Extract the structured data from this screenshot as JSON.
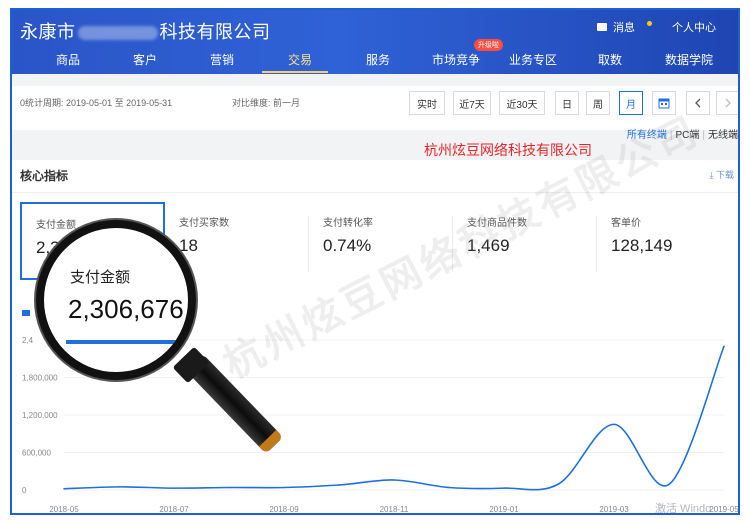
{
  "header": {
    "title_prefix": "永康市",
    "title_suffix": "科技有限公司",
    "messages_label": "消息",
    "user_center_label": "个人中心"
  },
  "nav": {
    "items": [
      {
        "label": "商品"
      },
      {
        "label": "客户"
      },
      {
        "label": "营销"
      },
      {
        "label": "交易"
      },
      {
        "label": "服务"
      },
      {
        "label": "市场竞争"
      },
      {
        "label": "业务专区"
      },
      {
        "label": "取数"
      },
      {
        "label": "数据学院"
      }
    ],
    "active": "交易",
    "upgrade_badge": "升级啦"
  },
  "filter": {
    "period_label": "0统计周期:",
    "period_value": "2019-05-01 至 2019-05-31",
    "compare_label": "对比维度:",
    "compare_value": "前一月",
    "buttons": [
      "实时",
      "近7天",
      "近30天",
      "日",
      "周",
      "月"
    ],
    "active_button": "月"
  },
  "terminal": {
    "all": "所有终端",
    "pc": "PC端",
    "wireless": "无线端"
  },
  "company_overlay": "杭州炫豆网络科技有限公司",
  "core": {
    "title": "核心指标",
    "download": "下载",
    "metrics": [
      {
        "label": "支付金额",
        "value": "2,306,676"
      },
      {
        "label": "支付买家数",
        "value": "18"
      },
      {
        "label": "支付转化率",
        "value": "0.74%"
      },
      {
        "label": "支付商品件数",
        "value": "1,469"
      },
      {
        "label": "客单价",
        "value": "128,149"
      }
    ]
  },
  "magnifier": {
    "label": "支付金额",
    "value": "2,306,676"
  },
  "watermark": "杭州炫豆网络科技有限公司",
  "activate_text": "激活 Windo",
  "colors": {
    "accent": "#1f6fe0",
    "header": "#2a55c8",
    "red": "#e8242a"
  },
  "chart_data": {
    "type": "line",
    "x": [
      "2018-05",
      "2018-06",
      "2018-07",
      "2018-08",
      "2018-09",
      "2018-10",
      "2018-11",
      "2018-12",
      "2019-01",
      "2019-02",
      "2019-03",
      "2019-04",
      "2019-05"
    ],
    "x_ticks": [
      "2018-05",
      "2018-07",
      "2018-09",
      "2018-11",
      "2019-01",
      "2019-03",
      "2019-05"
    ],
    "series": [
      {
        "values": [
          20000,
          50000,
          30000,
          40000,
          40000,
          80000,
          160000,
          40000,
          30000,
          100000,
          1050000,
          90000,
          2300000
        ]
      }
    ],
    "y_ticks": [
      "0",
      "600,000",
      "1,200,000",
      "1,800,000",
      "2,4"
    ],
    "ylim": [
      0,
      2400000
    ]
  }
}
